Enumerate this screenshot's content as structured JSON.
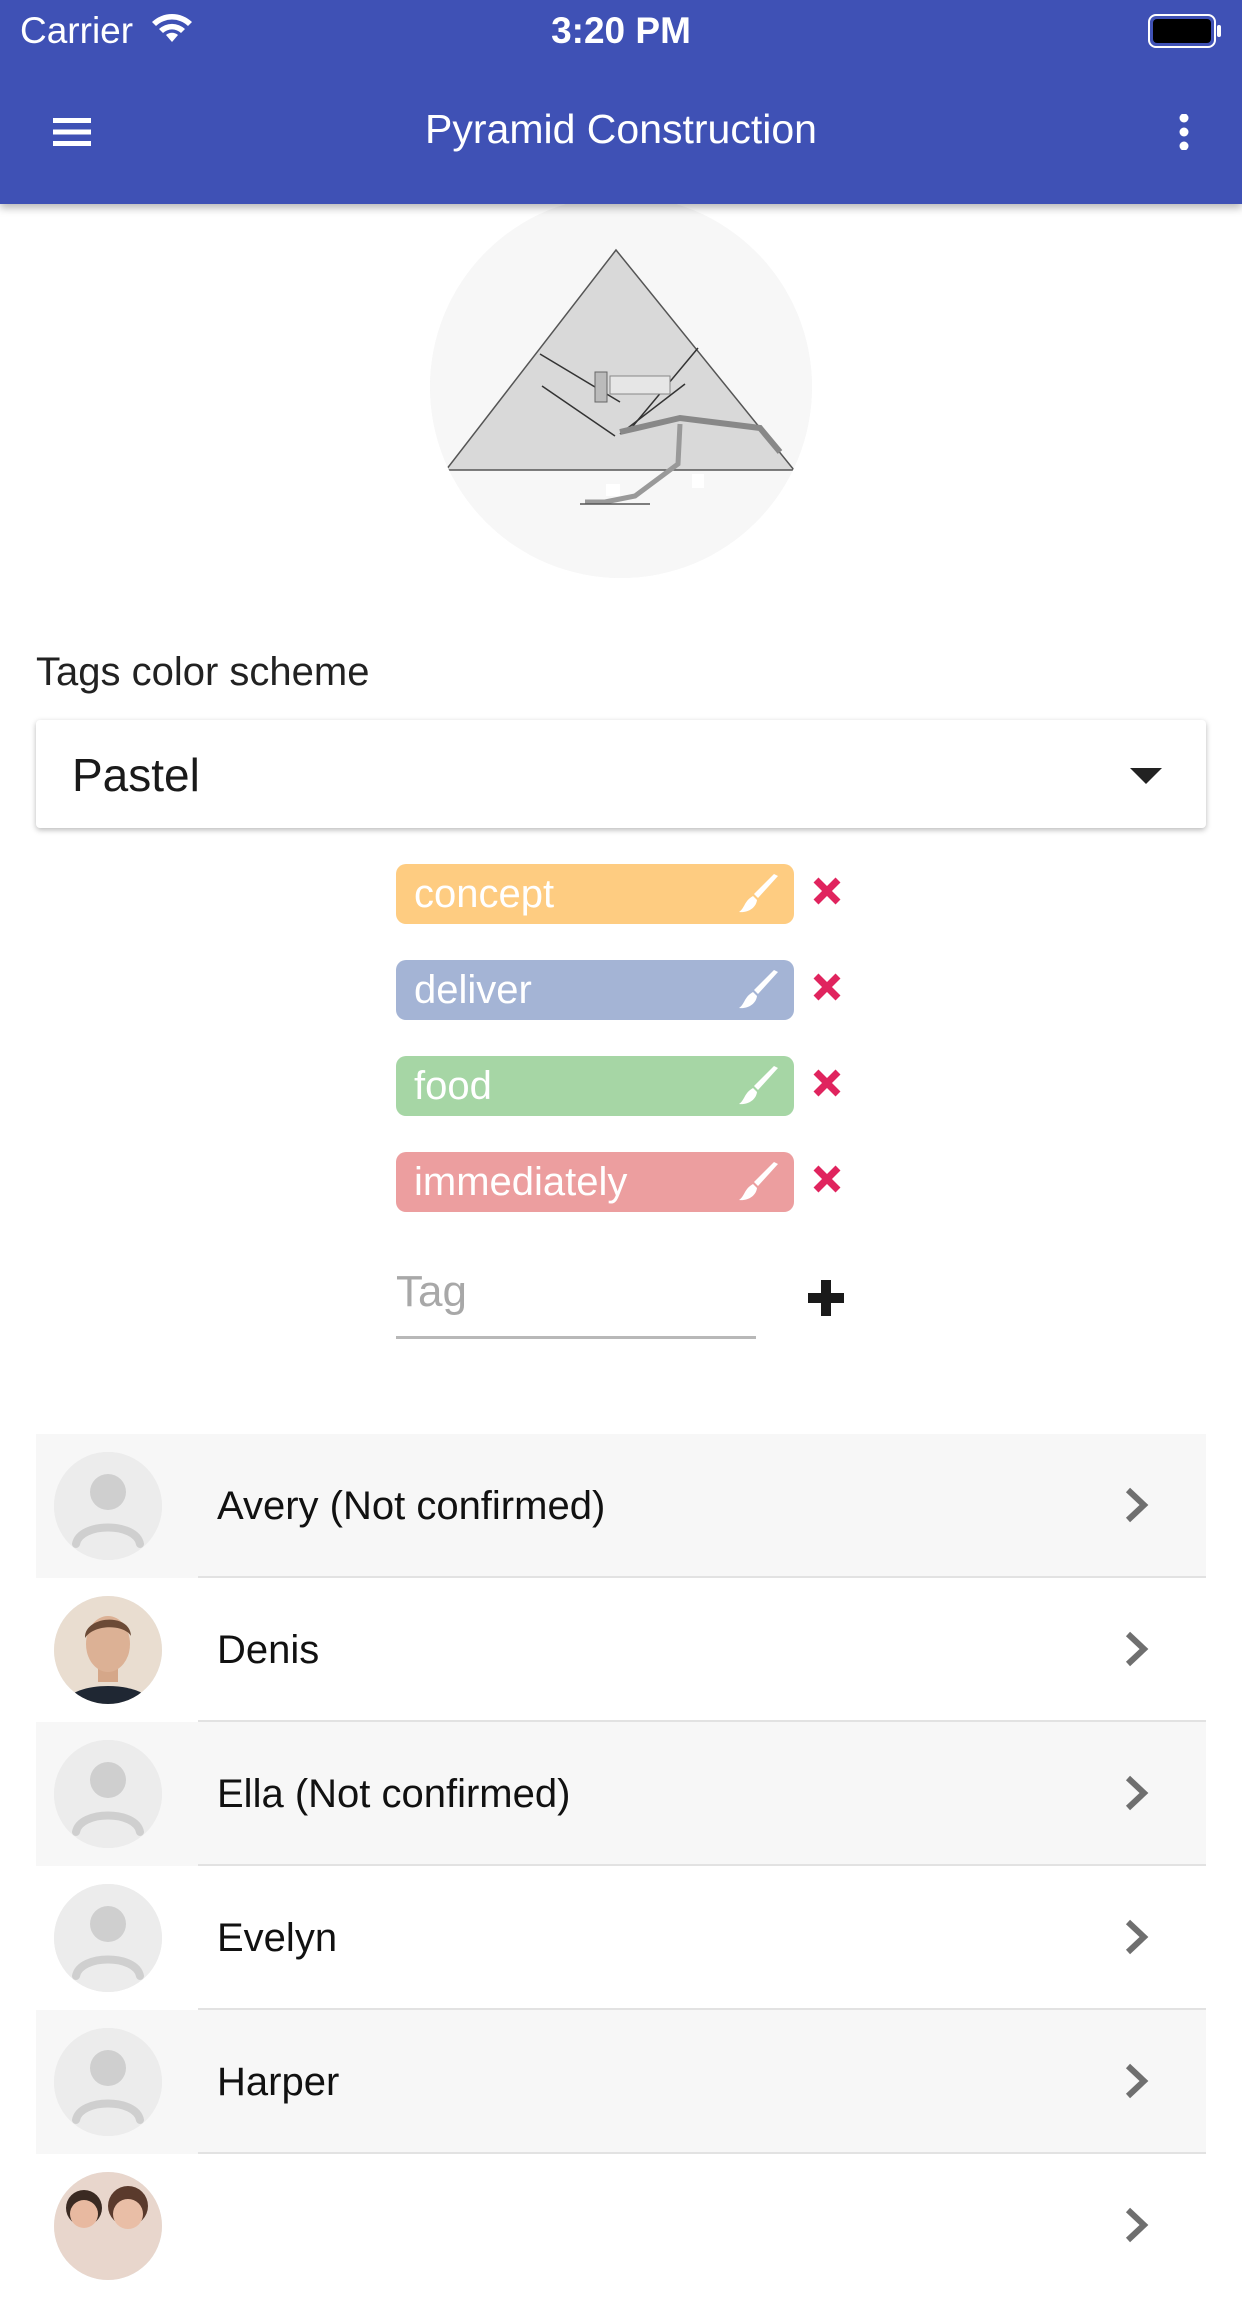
{
  "status_bar": {
    "carrier": "Carrier",
    "time": "3:20 PM"
  },
  "app_bar": {
    "title": "Pyramid Construction",
    "menu_icon": "hamburger-menu-icon",
    "more_icon": "more-vertical-icon"
  },
  "project_image": {
    "description_icon": "pyramid-cross-section-image"
  },
  "scheme": {
    "label": "Tags color scheme",
    "selected": "Pastel"
  },
  "tags": [
    {
      "label": "concept",
      "color": "#fecc81"
    },
    {
      "label": "deliver",
      "color": "#a4b4d5"
    },
    {
      "label": "food",
      "color": "#a6d6a5"
    },
    {
      "label": "immediately",
      "color": "#ec9e9f"
    }
  ],
  "colors": {
    "accent": "#3f51b5",
    "remove": "#e0245e"
  },
  "new_tag": {
    "placeholder": "Tag"
  },
  "members": [
    {
      "name": "Avery (Not confirmed)",
      "avatar": "placeholder"
    },
    {
      "name": "Denis",
      "avatar": "photo"
    },
    {
      "name": "Ella (Not confirmed)",
      "avatar": "placeholder"
    },
    {
      "name": "Evelyn",
      "avatar": "placeholder"
    },
    {
      "name": "Harper",
      "avatar": "placeholder"
    },
    {
      "name": "",
      "avatar": "photo-group"
    }
  ]
}
